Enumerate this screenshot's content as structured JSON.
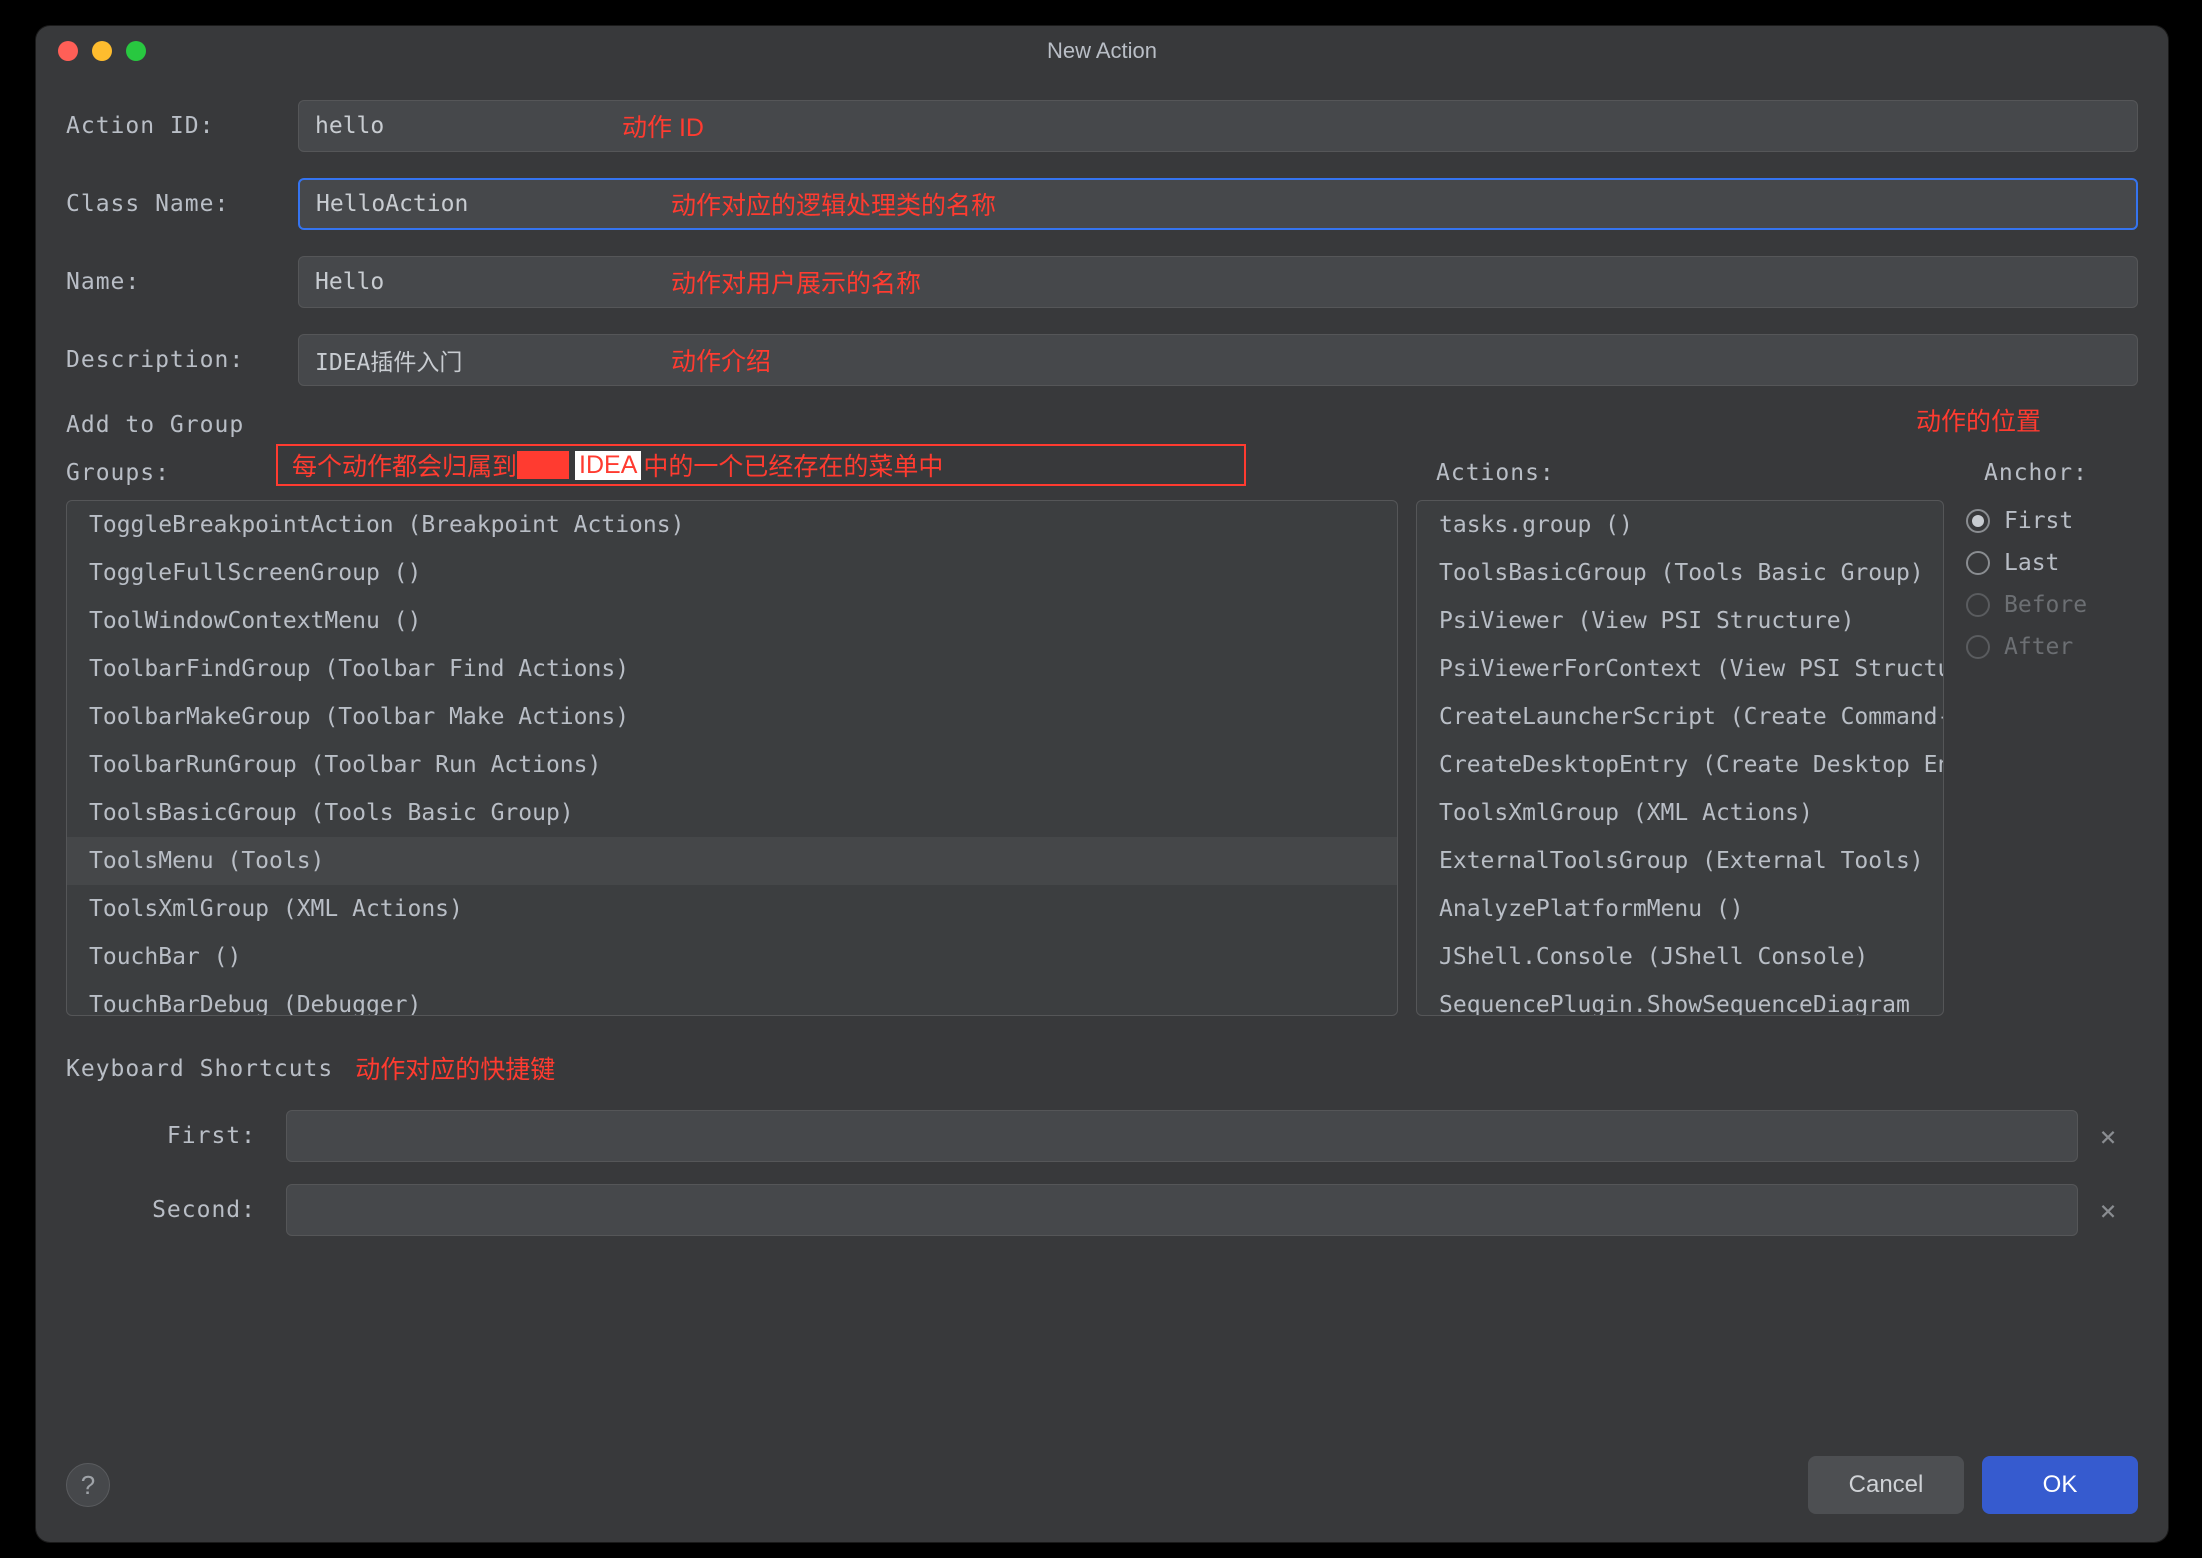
{
  "window": {
    "title": "New Action"
  },
  "fields": {
    "action_id": {
      "label": "Action ID:",
      "value": "hello"
    },
    "class_name": {
      "label": "Class Name:",
      "value": "HelloAction"
    },
    "name": {
      "label": "Name:",
      "value": "Hello"
    },
    "description": {
      "label": "Description:",
      "value": "IDEA插件入门"
    }
  },
  "annotations": {
    "action_id": "动作 ID",
    "class_name": "动作对应的逻辑处理类的名称",
    "name": "动作对用户展示的名称",
    "description": "动作介绍",
    "position": "动作的位置",
    "groups_note_pre": "每个动作都会归属到",
    "groups_note_mid": "IDEA",
    "groups_note_post": "中的一个已经存在的菜单中",
    "shortcuts": "动作对应的快捷键"
  },
  "add_to_group": {
    "section": "Add to Group",
    "groups_label": "Groups:",
    "actions_label": "Actions:",
    "anchor_label": "Anchor:",
    "groups": [
      "ToggleBreakpointAction (Breakpoint Actions)",
      "ToggleFullScreenGroup ()",
      "ToolWindowContextMenu ()",
      "ToolbarFindGroup (Toolbar Find Actions)",
      "ToolbarMakeGroup (Toolbar Make Actions)",
      "ToolbarRunGroup (Toolbar Run Actions)",
      "ToolsBasicGroup (Tools Basic Group)",
      "ToolsMenu (Tools)",
      "ToolsXmlGroup (XML Actions)",
      "TouchBar ()",
      "TouchBarDebug (Debugger)"
    ],
    "groups_selected_index": 7,
    "actions": [
      "tasks.group ()",
      "ToolsBasicGroup (Tools Basic Group)",
      "PsiViewer (View PSI Structure)",
      "PsiViewerForContext (View PSI Structure for Context)",
      "CreateLauncherScript (Create Command-line Launcher)",
      "CreateDesktopEntry (Create Desktop Entry)",
      "ToolsXmlGroup (XML Actions)",
      "ExternalToolsGroup (External Tools)",
      "AnalyzePlatformMenu ()",
      "JShell.Console (JShell Console)",
      "SequencePlugin.ShowSequenceDiagram"
    ],
    "anchor_options": [
      "First",
      "Last",
      "Before",
      "After"
    ],
    "anchor_selected": "First",
    "anchor_disabled": [
      "Before",
      "After"
    ]
  },
  "shortcuts": {
    "section": "Keyboard Shortcuts",
    "first_label": "First:",
    "second_label": "Second:",
    "first_value": "",
    "second_value": ""
  },
  "buttons": {
    "cancel": "Cancel",
    "ok": "OK"
  },
  "icons": {
    "help": "?",
    "clear": "×"
  }
}
